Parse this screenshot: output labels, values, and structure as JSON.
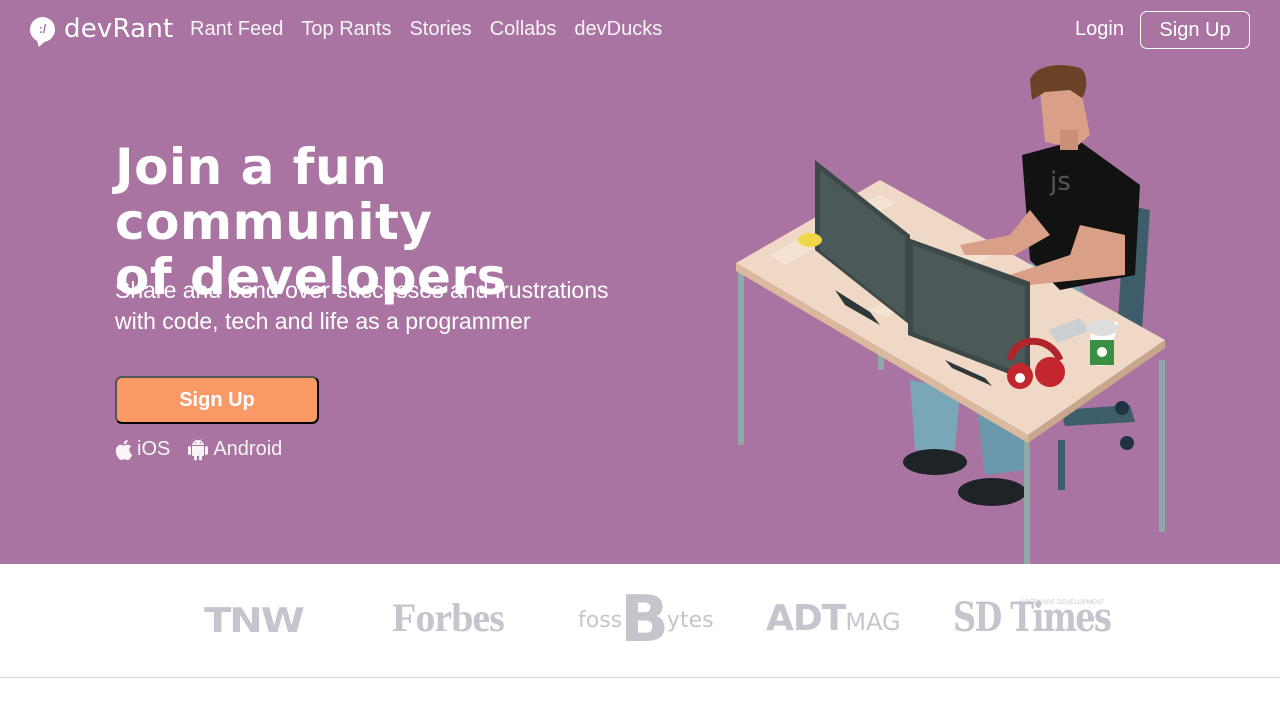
{
  "brand": {
    "name": "devRant",
    "bubble_glyph": ":/"
  },
  "nav": {
    "links": [
      "Rant Feed",
      "Top Rants",
      "Stories",
      "Collabs",
      "devDucks"
    ],
    "login": "Login",
    "signup": "Sign Up"
  },
  "hero": {
    "headline_line1": "Join a fun community",
    "headline_line2": "of developers",
    "subhead_line1": "Share and bond over successes and frustrations",
    "subhead_line2": "with code, tech and life as a programmer",
    "cta": "Sign Up",
    "apps": [
      {
        "label": "iOS",
        "icon": "apple-icon"
      },
      {
        "label": "Android",
        "icon": "android-icon"
      }
    ],
    "shirt_text": "js"
  },
  "press": {
    "logos": [
      "TNW",
      "Forbes",
      "fossBytes",
      "ADTMAG",
      "SD Times"
    ],
    "tnw": "TNW",
    "forbes": "Forbes",
    "fossbytes_a": "foss",
    "fossbytes_b": "B",
    "fossbytes_c": "ytes",
    "adtmag_a": "ADT",
    "adtmag_b": "MAG",
    "sdtimes": "SD Times",
    "sdtimes_small": "SOFTWARE DEVELOPMENT"
  },
  "colors": {
    "hero_bg": "#a973a2",
    "cta_bg": "#f99a66",
    "press_logo": "#c6c5cd"
  }
}
